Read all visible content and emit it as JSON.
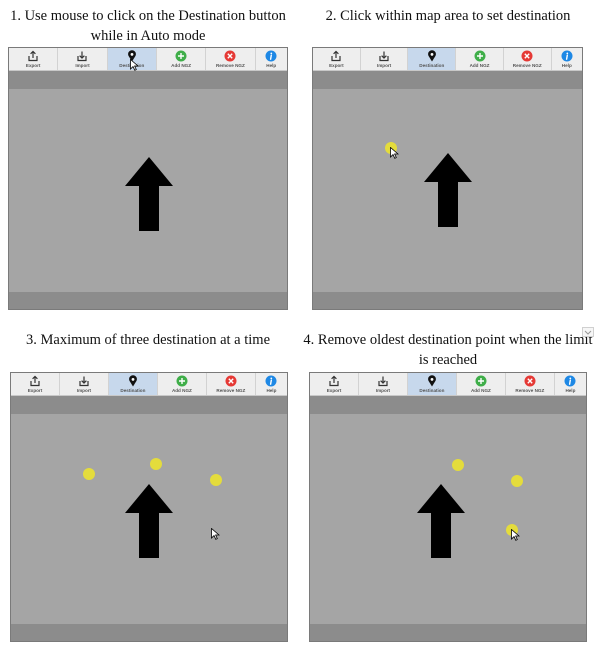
{
  "theme": {
    "map_bg": "#a5a5a5",
    "bar_bg": "#8c8c8c",
    "toolbar_bg": "#eeeeee",
    "active_bg": "#c7d8ec",
    "dot_color": "#e4dc3c",
    "add_color": "#3fae49",
    "remove_color": "#e53935",
    "help_color": "#1e88e5"
  },
  "toolbar": [
    {
      "key": "export",
      "label": "Export",
      "icon": "export-icon"
    },
    {
      "key": "import",
      "label": "Import",
      "icon": "import-icon"
    },
    {
      "key": "destination",
      "label": "Destination",
      "icon": "location-pin-icon"
    },
    {
      "key": "add_ngz",
      "label": "Add NGZ",
      "icon": "plus-circle-icon"
    },
    {
      "key": "remove_ngz",
      "label": "Remove NGZ",
      "icon": "x-circle-icon"
    },
    {
      "key": "help",
      "label": "Help",
      "icon": "info-icon"
    }
  ],
  "steps": [
    {
      "caption": "1. Use mouse to click on the Destination button while in Auto mode",
      "active_button": "destination",
      "cursor_on_button": true
    },
    {
      "caption": "2. Click within map area to set destination",
      "active_button": "destination",
      "destinations_count": 1
    },
    {
      "caption": "3. Maximum of three destination at a time",
      "active_button": "destination",
      "destinations_count": 3
    },
    {
      "caption": "4. Remove oldest destination point when the limit is reached",
      "active_button": "destination",
      "destinations_count": 3
    }
  ]
}
